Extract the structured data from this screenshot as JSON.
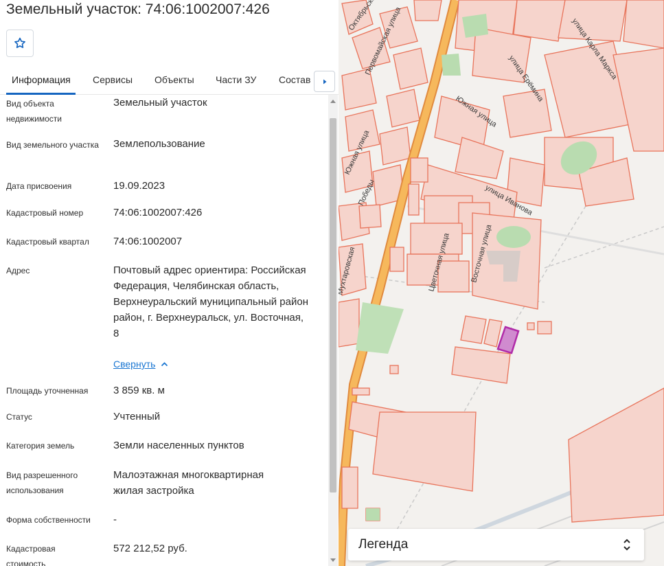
{
  "header": {
    "title": "Земельный участок: 74:06:1002007:426"
  },
  "icons": {
    "favorite": "star-outline-icon",
    "tabs_scroll": "chevron-right-icon",
    "collapse": "chevron-up-icon",
    "legend_toggle": "unfold-icon"
  },
  "tabs": [
    {
      "label": "Информация",
      "active": true
    },
    {
      "label": "Сервисы"
    },
    {
      "label": "Объекты"
    },
    {
      "label": "Части ЗУ"
    },
    {
      "label": "Состав"
    }
  ],
  "properties": [
    {
      "label": "Вид объекта недвижимости",
      "value": "Земельный участок"
    },
    {
      "label": "Вид земельного участка",
      "value": "Землепользование"
    },
    {
      "label": "Дата присвоения",
      "value": "19.09.2023"
    },
    {
      "label": "Кадастровый номер",
      "value": "74:06:1002007:426"
    },
    {
      "label": "Кадастровый квартал",
      "value": "74:06:1002007"
    },
    {
      "label": "Адрес",
      "value": "Почтовый адрес ориентира: Российская Федерация, Челябинская область, Верхнеуральский муниципальный район район, г. Верхнеуральск, ул. Восточная, 8"
    },
    {
      "label": "Площадь уточненная",
      "value": "3 859 кв. м"
    },
    {
      "label": "Статус",
      "value": "Учтенный"
    },
    {
      "label": "Категория земель",
      "value": "Земли населенных пунктов"
    },
    {
      "label": "Вид разрешенного использования",
      "value": "Малоэтажная многоквартирная жилая застройка"
    },
    {
      "label": "Форма собственности",
      "value": "-"
    },
    {
      "label": "Кадастровая стоимость",
      "value": "572 212,52 руб."
    }
  ],
  "collapse_link": "Свернуть",
  "map": {
    "streets": [
      "улица Ерёмина",
      "улица Карла Маркса",
      "Южная улица",
      "улица Иванова",
      "Цветочная улица",
      "Восточная улица",
      "Первомайская улица",
      "Октябрьская",
      "Южная улица",
      "Победы",
      "Мухтаровская"
    ],
    "colors": {
      "parcel_stroke": "#e8735a",
      "parcel_fill": "#f6d4cc",
      "selected_parcel": "#b02aa8",
      "road_main": "#f0a64d",
      "green": "#b9dcb0"
    }
  },
  "legend": {
    "title": "Легенда"
  }
}
